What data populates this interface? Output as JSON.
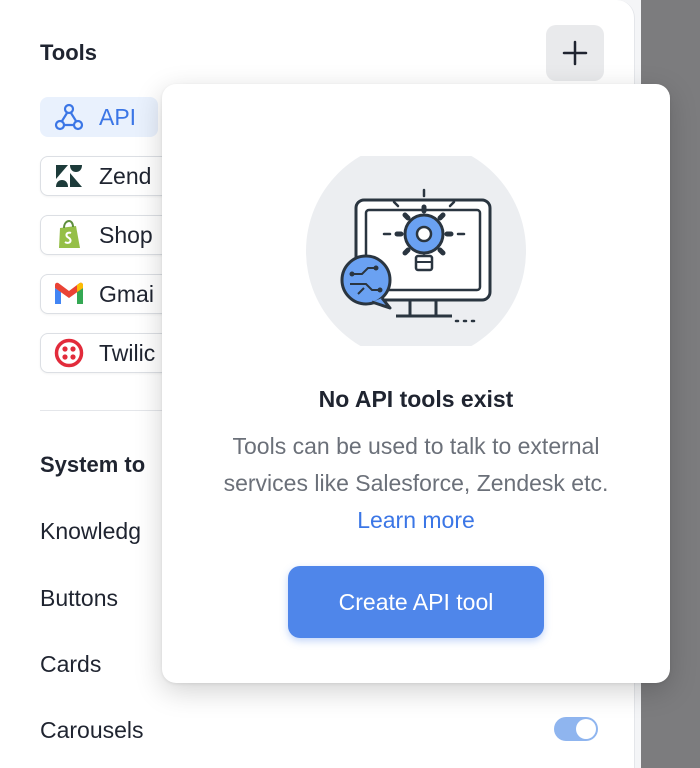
{
  "sidebar": {
    "tools_title": "Tools",
    "add_label": "+",
    "tools": [
      {
        "label": "API",
        "icon": "api-icon",
        "active": true
      },
      {
        "label": "Zend",
        "icon": "zendesk-icon"
      },
      {
        "label": "Shop",
        "icon": "shopify-icon"
      },
      {
        "label": "Gmai",
        "icon": "gmail-icon"
      },
      {
        "label": "Twilic",
        "icon": "twilio-icon"
      }
    ],
    "system_title": "System to",
    "system_items": [
      "Knowledg",
      "Buttons",
      "Cards",
      "Carousels"
    ]
  },
  "popover": {
    "title": "No API tools exist",
    "desc_before": "Tools can be used to talk to external services like Salesforce, Zendesk etc. ",
    "link": "Learn more",
    "button": "Create API tool"
  },
  "colors": {
    "accent": "#4f86ea",
    "link": "#3b76e6",
    "active_chip": "#e9f1fd"
  }
}
